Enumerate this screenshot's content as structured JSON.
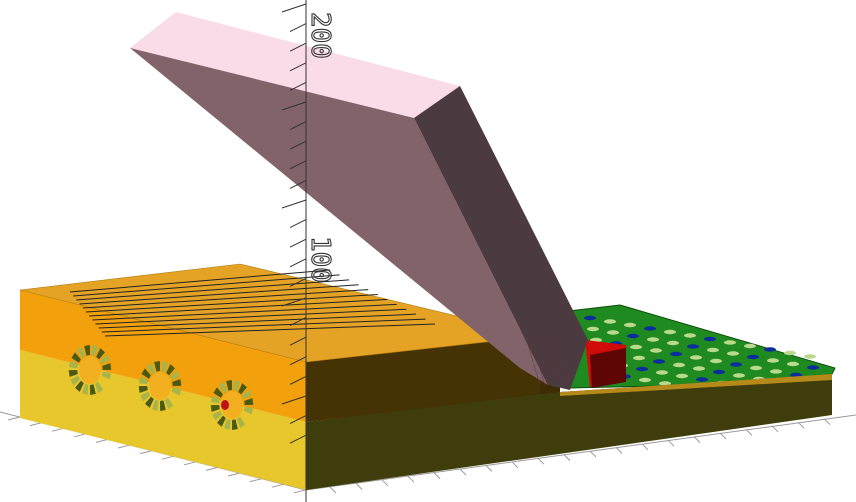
{
  "viewport": {
    "background": "#ffffff",
    "axis_labels": [
      "200",
      "100"
    ]
  },
  "model": {
    "lid": {
      "top_color": "#fadbe8",
      "front_color": "#82636a",
      "side_color": "#4b3a3f"
    },
    "case": {
      "top_color": "#e4a324",
      "upper_front_color": "#f2a00c",
      "lower_front_color": "#e8c72c",
      "right_side_color": "#453306",
      "right_lower_color": "#3f3d0b"
    },
    "keyboard_grid": {
      "color": "#1f8a1f",
      "hole_color": "#0b2e9a"
    },
    "cube": {
      "color": "#d10a0a"
    },
    "coil_icons": [
      "coil-icon",
      "coil-icon",
      "coil-icon"
    ]
  }
}
